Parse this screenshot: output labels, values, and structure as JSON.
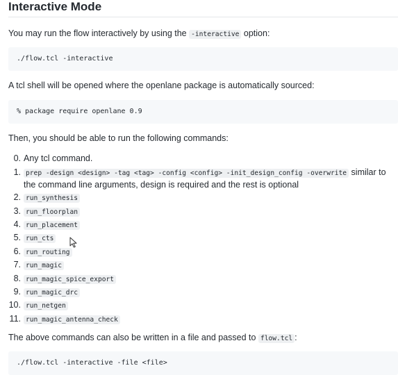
{
  "heading": "Interactive Mode",
  "intro": {
    "before": "You may run the flow interactively by using the ",
    "code": "-interactive",
    "after": " option:"
  },
  "code_block_1": "./flow.tcl -interactive",
  "shell_text": "A tcl shell will be opened where the openlane package is automatically sourced:",
  "code_block_2": "% package require openlane 0.9",
  "commands_intro": "Then, you should be able to run the following commands:",
  "commands": {
    "item0": {
      "num": "0.",
      "text": "Any tcl command."
    },
    "item1": {
      "num": "1.",
      "code": "prep -design <design> -tag <tag> -config <config> -init_design_config -overwrite",
      "text": " similar to the command line arguments, design is required and the rest is optional"
    },
    "rows": [
      {
        "num": "2.",
        "code": "run_synthesis"
      },
      {
        "num": "3.",
        "code": "run_floorplan"
      },
      {
        "num": "4.",
        "code": "run_placement"
      },
      {
        "num": "5.",
        "code": "run_cts"
      },
      {
        "num": "6.",
        "code": "run_routing"
      },
      {
        "num": "7.",
        "code": "run_magic"
      },
      {
        "num": "8.",
        "code": "run_magic_spice_export"
      },
      {
        "num": "9.",
        "code": "run_magic_drc"
      },
      {
        "num": "10.",
        "code": "run_netgen"
      },
      {
        "num": "11.",
        "code": "run_magic_antenna_check"
      }
    ]
  },
  "file_text": {
    "before": "The above commands can also be written in a file and passed to ",
    "code": "flow.tcl",
    "after": ":"
  },
  "code_block_3": "./flow.tcl -interactive -file <file>",
  "icons": {
    "cursor": "mouse-pointer-icon"
  }
}
